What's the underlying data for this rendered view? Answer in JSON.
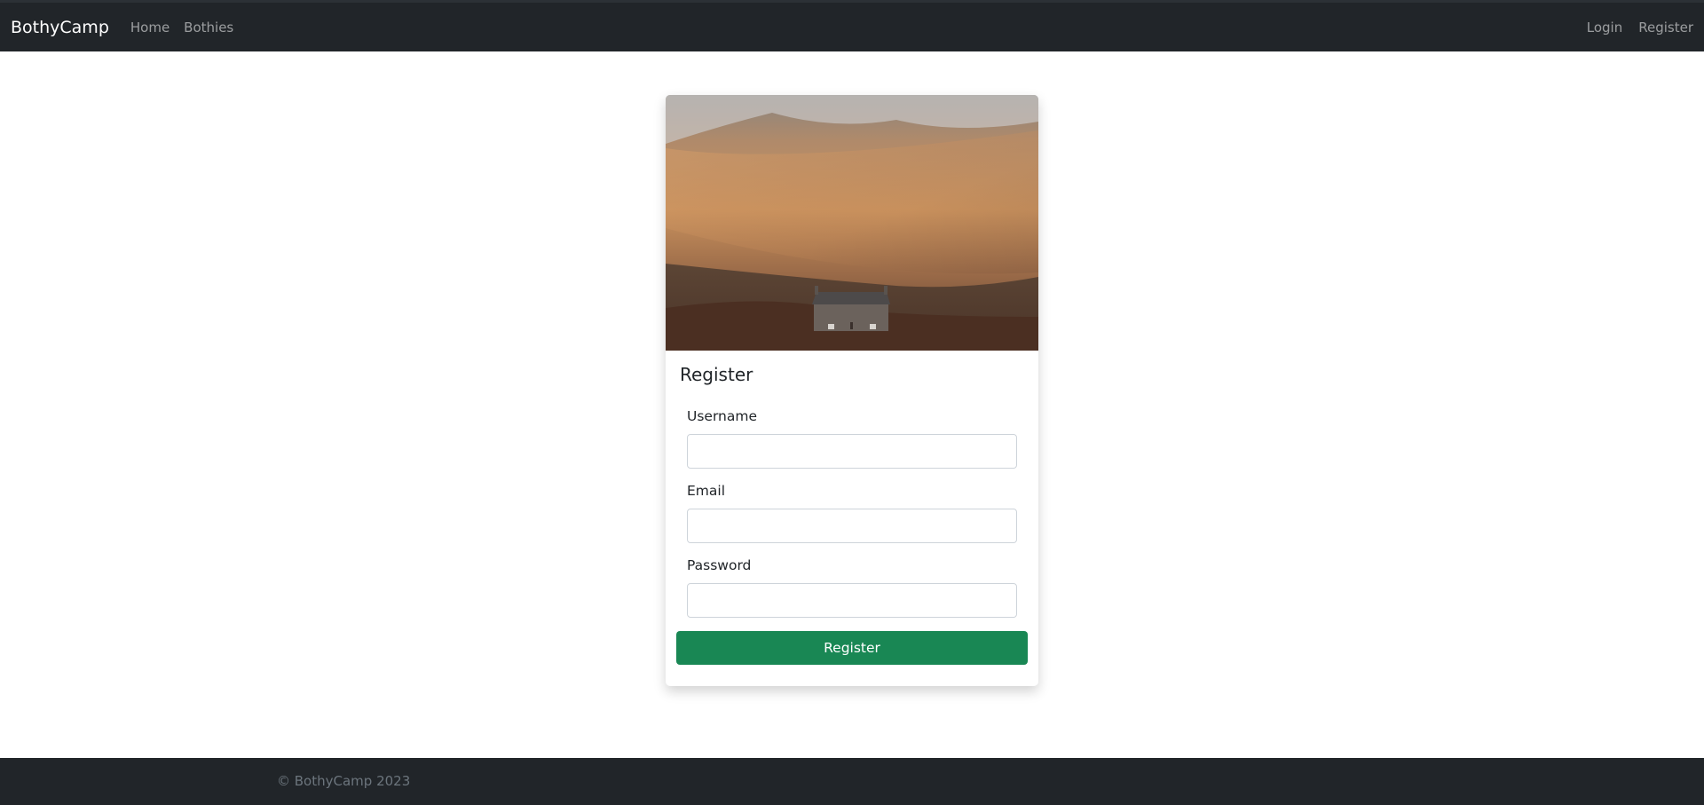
{
  "navbar": {
    "brand": "BothyCamp",
    "links": [
      "Home",
      "Bothies"
    ],
    "right_links": [
      "Login",
      "Register"
    ]
  },
  "card": {
    "title": "Register",
    "fields": [
      {
        "label": "Username",
        "value": "",
        "placeholder": ""
      },
      {
        "label": "Email",
        "value": "",
        "placeholder": ""
      },
      {
        "label": "Password",
        "value": "",
        "placeholder": ""
      }
    ],
    "submit_label": "Register"
  },
  "footer": {
    "text": "© BothyCamp 2023"
  },
  "colors": {
    "navbar_bg": "#212529",
    "submit_bg": "#198754",
    "footer_text": "#6c757d"
  }
}
